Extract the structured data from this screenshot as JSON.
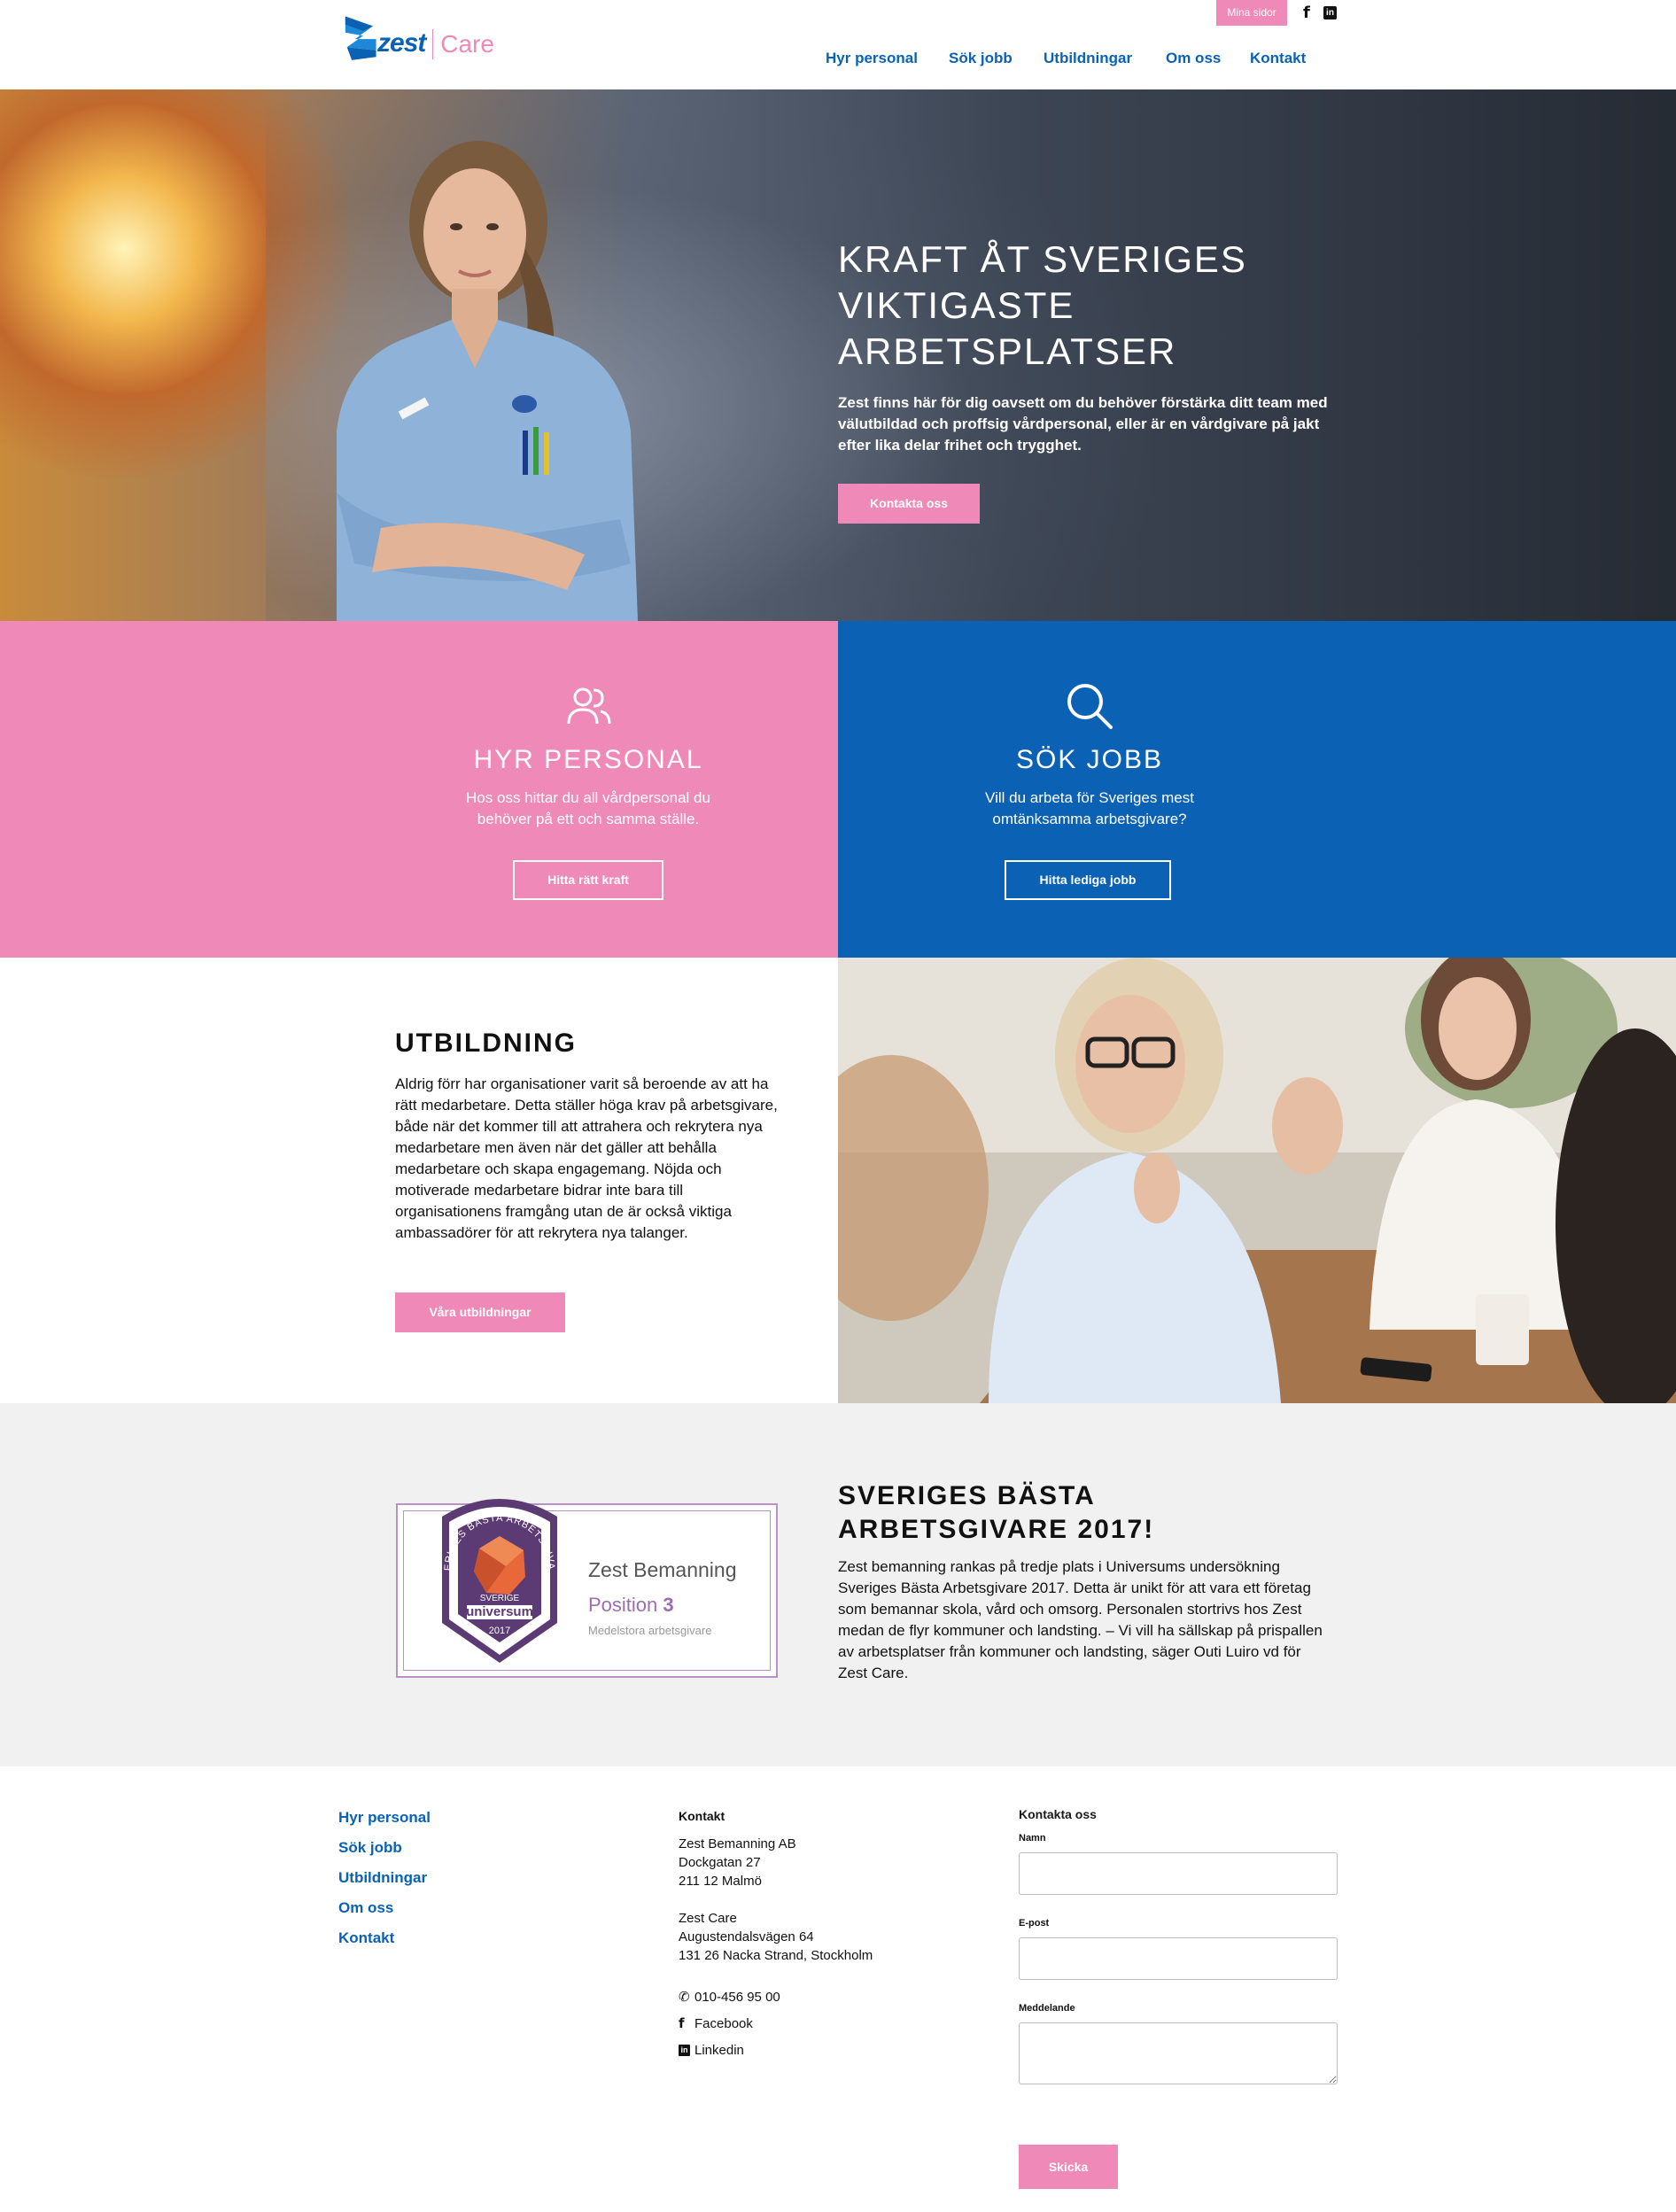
{
  "header": {
    "logo_word": "zest",
    "logo_care": "Care",
    "mina_sidor": "Mina sidor",
    "facebook_glyph": "f",
    "linkedin_glyph": "in",
    "nav": [
      "Hyr personal",
      "Sök jobb",
      "Utbildningar",
      "Om oss",
      "Kontakt"
    ]
  },
  "hero": {
    "title": "KRAFT ÅT SVERIGES VIKTIGASTE ARBETSPLATSER",
    "text": "Zest finns här för dig oavsett om du behöver förstärka ditt team med välutbildad och proffsig vårdpersonal, eller är en vårdgivare på jakt efter lika delar frihet och trygghet.",
    "button": "Kontakta oss"
  },
  "cta": {
    "hyr": {
      "icon": "users-icon",
      "title": "HYR PERSONAL",
      "text": "Hos oss hittar du all vårdpersonal du behöver på ett och samma ställe.",
      "button": "Hitta rätt kraft"
    },
    "sok": {
      "icon": "search-icon",
      "title": "SÖK JOBB",
      "text": "Vill du arbeta för Sveriges mest omtänksamma arbetsgivare?",
      "button": "Hitta lediga jobb"
    }
  },
  "utbildning": {
    "title": "UTBILDNING",
    "text": "Aldrig förr har organisationer varit så beroende av att ha rätt medarbetare. Detta ställer höga krav på arbetsgivare, både när det kommer till att attrahera och rekrytera nya medarbetare men även när det gäller att behålla medarbetare och skapa engagemang. Nöjda och motiverade medarbetare bidrar inte bara till organisationens framgång utan de är också viktiga ambassadörer för att rekrytera nya talanger.",
    "button": "Våra utbildningar"
  },
  "award": {
    "badge": {
      "arc_text": "SVERIGES BÄSTA ARBETSGIVARE",
      "country": "SVERIGE",
      "brand": "universum",
      "year": "2017",
      "company": "Zest Bemanning",
      "position_label": "Position",
      "position_value": "3",
      "category": "Medelstora arbetsgivare"
    },
    "title": "SVERIGES BÄSTA ARBETSGIVARE 2017!",
    "text": "Zest bemanning rankas på tredje plats i Universums undersökning Sveriges Bästa Arbetsgivare 2017. Detta är unikt för att vara ett företag som bemannar skola, vård och omsorg. Personalen stortrivs hos Zest medan de flyr kommuner och landsting. – Vi vill ha sällskap på prispallen av arbetsplatser från kommuner och landsting, säger Outi Luiro vd för Zest Care."
  },
  "footer": {
    "links": [
      "Hyr personal",
      "Sök jobb",
      "Utbildningar",
      "Om oss",
      "Kontakt"
    ],
    "contact": {
      "heading": "Kontakt",
      "office1": [
        "Zest Bemanning AB",
        "Dockgatan 27",
        "211 12 Malmö"
      ],
      "office2": [
        "Zest Care",
        "Augustendalsvägen 64",
        "131 26 Nacka Strand, Stockholm"
      ],
      "phone": "010-456 95 00",
      "facebook": "Facebook",
      "linkedin": "Linkedin"
    },
    "form": {
      "heading": "Kontakta oss",
      "name_label": "Namn",
      "email_label": "E-post",
      "message_label": "Meddelande",
      "submit": "Skicka"
    }
  },
  "colors": {
    "brand_blue": "#0b62b5",
    "brand_pink": "#ef89b8",
    "award_purple": "#5c3a73"
  }
}
